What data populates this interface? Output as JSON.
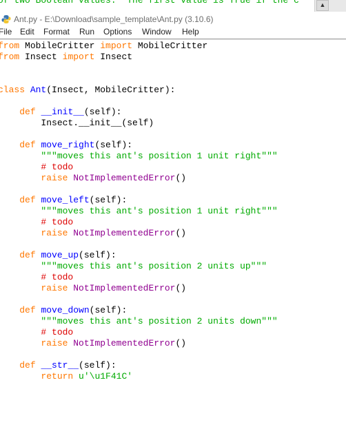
{
  "background_window": {
    "text": "of two Boolean values.  The first value is True if the c",
    "scroll_button_icon": "chevron-up-icon"
  },
  "window": {
    "icon": "python-icon",
    "title": "Ant.py - E:\\Download\\sample_template\\Ant.py (3.10.6)"
  },
  "menu": {
    "items": [
      {
        "label": "File"
      },
      {
        "label": "Edit"
      },
      {
        "label": "Format"
      },
      {
        "label": "Run"
      },
      {
        "label": "Options"
      },
      {
        "label": "Window"
      },
      {
        "label": "Help"
      }
    ]
  },
  "colors": {
    "keyword": "#ff7700",
    "definition": "#0000ff",
    "string": "#00aa00",
    "comment": "#dd0000",
    "builtin": "#900090",
    "default": "#000000"
  },
  "code": {
    "lines": [
      [
        {
          "t": "from",
          "c": "kw"
        },
        {
          "t": " MobileCritter "
        },
        {
          "t": "import",
          "c": "kw"
        },
        {
          "t": " MobileCritter"
        }
      ],
      [
        {
          "t": "from",
          "c": "kw"
        },
        {
          "t": " Insect "
        },
        {
          "t": "import",
          "c": "kw"
        },
        {
          "t": " Insect"
        }
      ],
      [],
      [],
      [
        {
          "t": "class",
          "c": "kw"
        },
        {
          "t": " "
        },
        {
          "t": "Ant",
          "c": "def"
        },
        {
          "t": "(Insect, MobileCritter):"
        }
      ],
      [],
      [
        {
          "t": "    "
        },
        {
          "t": "def",
          "c": "kw"
        },
        {
          "t": " "
        },
        {
          "t": "__init__",
          "c": "def"
        },
        {
          "t": "(self):"
        }
      ],
      [
        {
          "t": "        Insect.__init__(self)"
        }
      ],
      [],
      [
        {
          "t": "    "
        },
        {
          "t": "def",
          "c": "kw"
        },
        {
          "t": " "
        },
        {
          "t": "move_right",
          "c": "def"
        },
        {
          "t": "(self):"
        }
      ],
      [
        {
          "t": "        "
        },
        {
          "t": "\"\"\"moves this ant's position 1 unit right\"\"\"",
          "c": "str"
        }
      ],
      [
        {
          "t": "        "
        },
        {
          "t": "# todo",
          "c": "com"
        }
      ],
      [
        {
          "t": "        "
        },
        {
          "t": "raise",
          "c": "kw"
        },
        {
          "t": " "
        },
        {
          "t": "NotImplementedError",
          "c": "bi"
        },
        {
          "t": "()"
        }
      ],
      [],
      [
        {
          "t": "    "
        },
        {
          "t": "def",
          "c": "kw"
        },
        {
          "t": " "
        },
        {
          "t": "move_left",
          "c": "def"
        },
        {
          "t": "(self):"
        }
      ],
      [
        {
          "t": "        "
        },
        {
          "t": "\"\"\"moves this ant's position 1 unit right\"\"\"",
          "c": "str"
        }
      ],
      [
        {
          "t": "        "
        },
        {
          "t": "# todo",
          "c": "com"
        }
      ],
      [
        {
          "t": "        "
        },
        {
          "t": "raise",
          "c": "kw"
        },
        {
          "t": " "
        },
        {
          "t": "NotImplementedError",
          "c": "bi"
        },
        {
          "t": "()"
        }
      ],
      [],
      [
        {
          "t": "    "
        },
        {
          "t": "def",
          "c": "kw"
        },
        {
          "t": " "
        },
        {
          "t": "move_up",
          "c": "def"
        },
        {
          "t": "(self):"
        }
      ],
      [
        {
          "t": "        "
        },
        {
          "t": "\"\"\"moves this ant's position 2 units up\"\"\"",
          "c": "str"
        }
      ],
      [
        {
          "t": "        "
        },
        {
          "t": "# todo",
          "c": "com"
        }
      ],
      [
        {
          "t": "        "
        },
        {
          "t": "raise",
          "c": "kw"
        },
        {
          "t": " "
        },
        {
          "t": "NotImplementedError",
          "c": "bi"
        },
        {
          "t": "()"
        }
      ],
      [],
      [
        {
          "t": "    "
        },
        {
          "t": "def",
          "c": "kw"
        },
        {
          "t": " "
        },
        {
          "t": "move_down",
          "c": "def"
        },
        {
          "t": "(self):"
        }
      ],
      [
        {
          "t": "        "
        },
        {
          "t": "\"\"\"moves this ant's position 2 units down\"\"\"",
          "c": "str"
        }
      ],
      [
        {
          "t": "        "
        },
        {
          "t": "# todo",
          "c": "com"
        }
      ],
      [
        {
          "t": "        "
        },
        {
          "t": "raise",
          "c": "kw"
        },
        {
          "t": " "
        },
        {
          "t": "NotImplementedError",
          "c": "bi"
        },
        {
          "t": "()"
        }
      ],
      [],
      [
        {
          "t": "    "
        },
        {
          "t": "def",
          "c": "kw"
        },
        {
          "t": " "
        },
        {
          "t": "__str__",
          "c": "def"
        },
        {
          "t": "(self):"
        }
      ],
      [
        {
          "t": "        "
        },
        {
          "t": "return",
          "c": "kw"
        },
        {
          "t": " "
        },
        {
          "t": "u'\\u1F41C'",
          "c": "str"
        }
      ]
    ]
  }
}
